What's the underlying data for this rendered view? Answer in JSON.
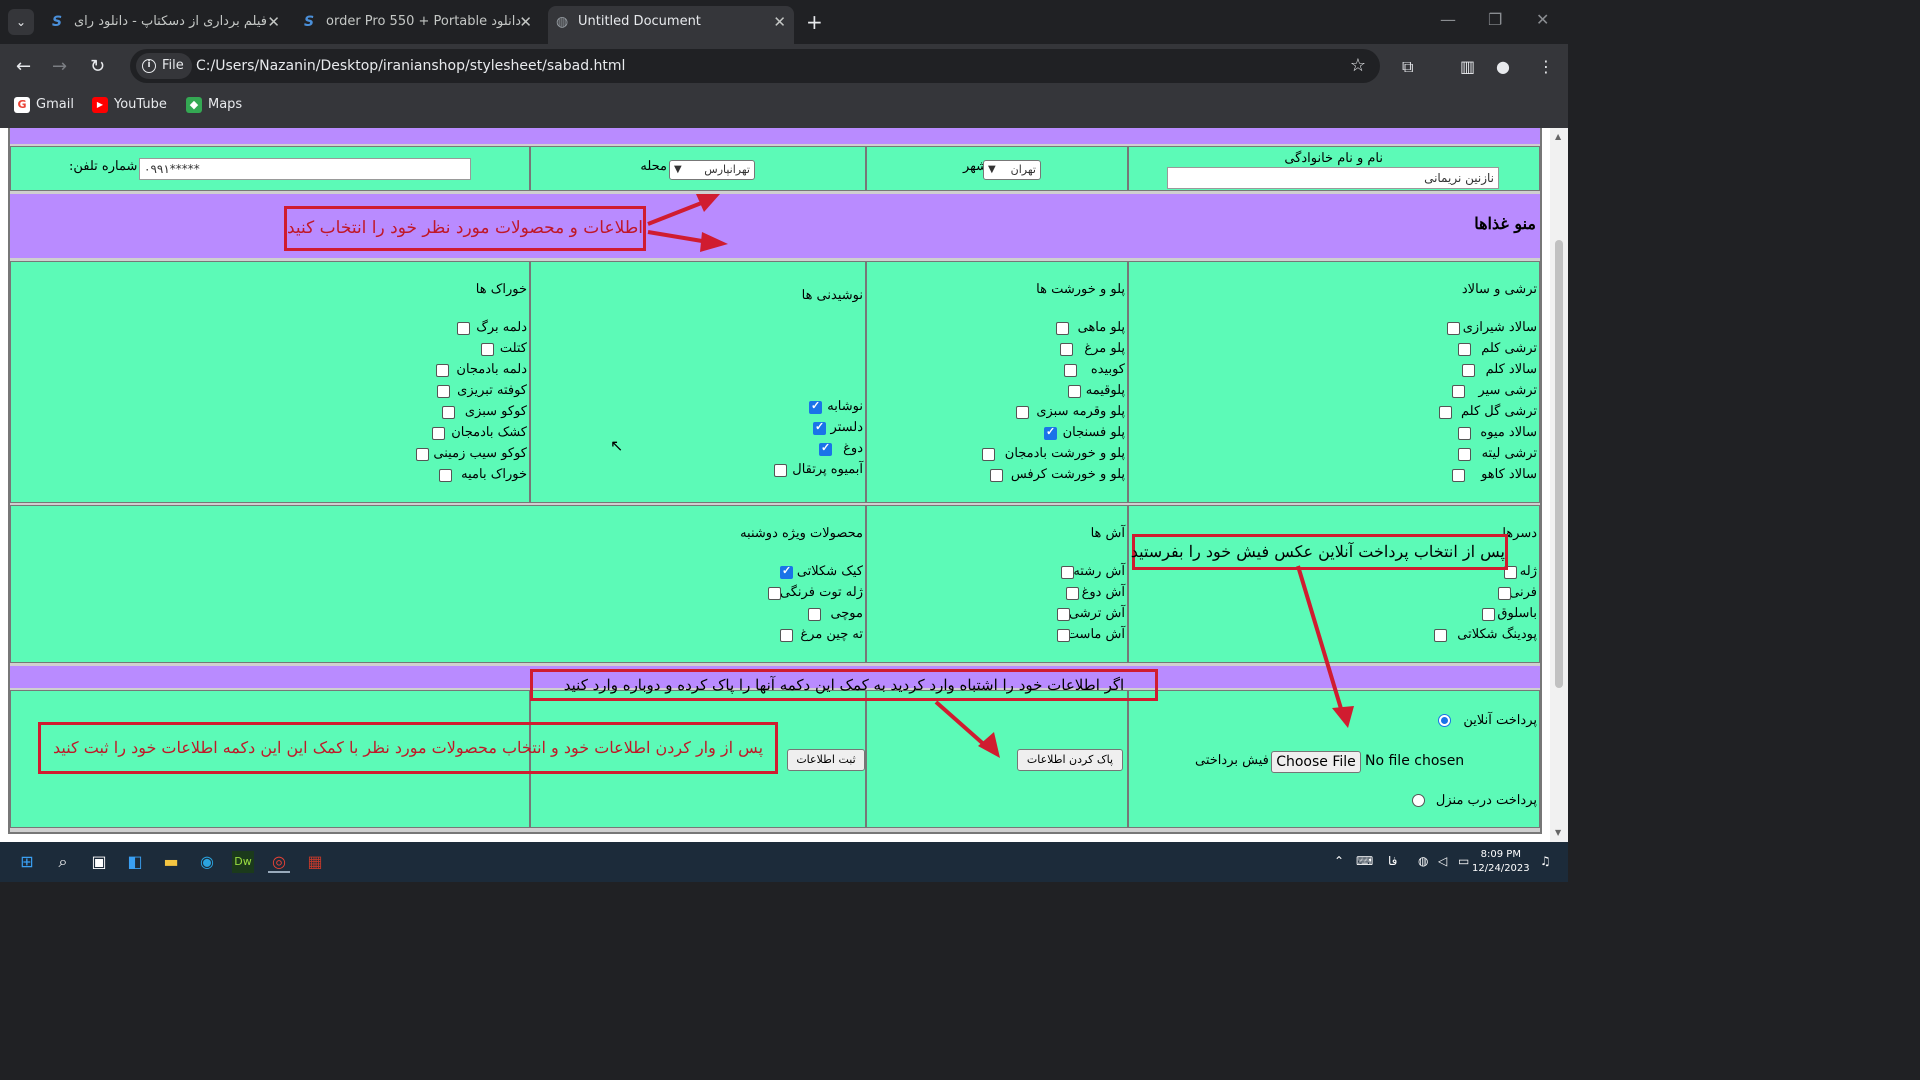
{
  "browser": {
    "tabs": [
      {
        "title": "فیلم برداری از دسکتاپ - دانلود رای"
      },
      {
        "title": "order Pro 550 + Portable دانلود"
      },
      {
        "title": "Untitled Document"
      }
    ],
    "address_chip": "File",
    "url": "C:/Users/Nazanin/Desktop/iranianshop/stylesheet/sabad.html",
    "bookmarks": [
      "Gmail",
      "YouTube",
      "Maps"
    ]
  },
  "form": {
    "name_label": "نام و نام خانوادگی",
    "name_value": "نازنین نریمانی",
    "city_label": "شهر",
    "city_value": "تهران",
    "district_label": "محله",
    "district_value": "تهرانپارس",
    "phone_label": ":شماره تلفن",
    "phone_value": "۰۹۹۱*****"
  },
  "menu_title": "منو غذاها",
  "sections": {
    "salads": {
      "heading": "ترشی و سالاد",
      "items": [
        "سالاد شیرازی",
        "ترشی کلم",
        "سالاد کلم",
        "ترشی سیر",
        "ترشی گل کلم",
        "سالاد میوه",
        "ترشی لیته",
        "سالاد کاهو"
      ],
      "checked": [
        false,
        false,
        false,
        false,
        false,
        false,
        false,
        false
      ]
    },
    "rice": {
      "heading": "پلو و خورشت ها",
      "items": [
        "پلو ماهی",
        "پلو مرغ",
        "کوبیده",
        "پلوقیمه",
        "پلو وقرمه سبزی",
        "پلو فسنجان",
        "پلو و خورشت بادمجان",
        "پلو و خورشت کرفس"
      ],
      "checked": [
        false,
        false,
        false,
        false,
        false,
        true,
        false,
        false
      ]
    },
    "drinks": {
      "heading": "نوشیدنی ها",
      "items": [
        "نوشابه",
        "دلستر",
        "دوغ",
        "آبمیوه پرتقال"
      ],
      "checked": [
        true,
        true,
        true,
        false
      ]
    },
    "foods": {
      "heading": "خوراک ها",
      "items": [
        "دلمه برگ",
        "کتلت",
        "دلمه بادمجان",
        "کوفته تبریزی",
        "کوکو سبزی",
        "کشک بادمجان",
        "کوکو سیب زمینی",
        "خوراک بامیه"
      ],
      "checked": [
        false,
        false,
        false,
        false,
        false,
        false,
        false,
        false
      ]
    },
    "desserts": {
      "heading": "دسرها",
      "items": [
        "ژله",
        "فرنی",
        "باسلوق",
        "پودینگ شکلاتی"
      ],
      "checked": [
        false,
        false,
        false,
        false
      ]
    },
    "soups": {
      "heading": "آش ها",
      "items": [
        "آش رشته",
        "آش دوغ",
        "آش ترشی",
        "آش ماست"
      ],
      "checked": [
        false,
        false,
        false,
        false
      ]
    },
    "special": {
      "heading": "محصولات ویژه دوشنبه",
      "items": [
        "کیک شکلاتی",
        "ژله توت فرنگی",
        "موچی",
        "ته چین مرغ"
      ],
      "checked": [
        true,
        false,
        false,
        false
      ]
    }
  },
  "payment": {
    "online_label": "پرداخت آنلاین",
    "receipt_label": "فیش برداختی",
    "choose_file": "Choose File",
    "no_file": "No file chosen",
    "door_label": "پرداخت درب منزل",
    "clear_button": "پاک کردن اطلاعات",
    "submit_button": "ثبت اطلاعات"
  },
  "annotations": {
    "select_products": "اطلاعات و محصولات مورد نظر خود را انتخاب کنید",
    "send_receipt": "پس از انتخاب پرداخت آنلاین عکس فیش خود را بفرستید",
    "clear_hint": "اگر اطلاعات خود را اشتباه وارد کردید به کمک این دکمه آنها را پاک کرده و دوباره وارد کنید",
    "submit_hint": "پس از وار کردن اطلاعات خود و انتخاب محصولات مورد نظر با کمک  این این دکمه اطلاعات خود را ثبت کنید"
  },
  "taskbar": {
    "time": "8:09 PM",
    "date": "12/24/2023",
    "lang": "فا"
  },
  "colors": {
    "band": "#b98bff",
    "cell": "#5cfab7",
    "annotation": "#d01c30"
  }
}
